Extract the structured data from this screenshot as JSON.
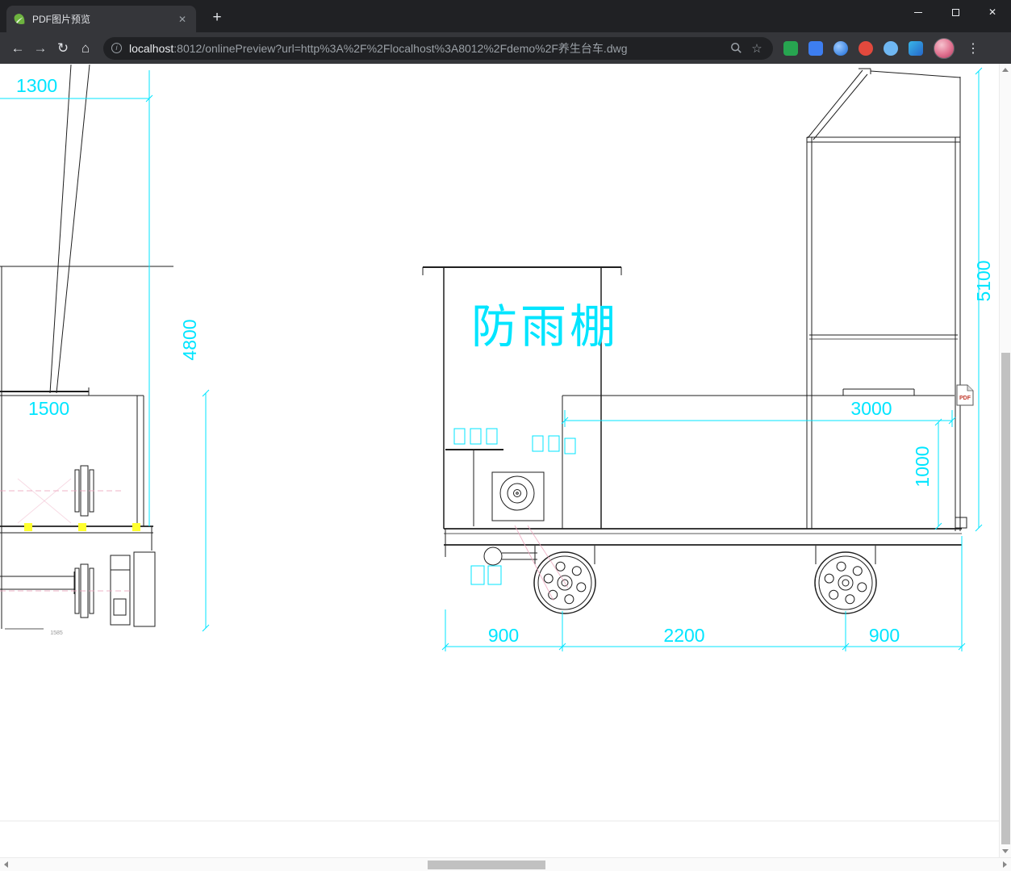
{
  "window": {
    "close_glyph": "✕"
  },
  "tabbar": {
    "tab_title": "PDF图片预览",
    "tab_close_glyph": "✕",
    "new_tab_glyph": "+"
  },
  "toolbar": {
    "back_glyph": "←",
    "forward_glyph": "→",
    "reload_glyph": "↻",
    "home_glyph": "⌂",
    "info_glyph": "i",
    "url_host": "localhost",
    "url_rest": ":8012/onlinePreview?url=http%3A%2F%2Flocalhost%3A8012%2Fdemo%2F养生台车.dwg",
    "star_glyph": "☆",
    "menu_glyph": "⋮",
    "extensions": [
      {
        "name": "green-extension",
        "style": "background:#27a550;border-radius:4px"
      },
      {
        "name": "translate-extension",
        "style": "background:#3d7ef0;border-radius:4px"
      },
      {
        "name": "blue-ball-extension",
        "style": "background:radial-gradient(circle at 35% 35%, #9ecbff, #1668d6);border-radius:50%"
      },
      {
        "name": "red-extension",
        "style": "background:#e2493d;border-radius:50%"
      },
      {
        "name": "cloud-extension",
        "style": "background:#6fb7f2;border-radius:50%"
      },
      {
        "name": "shield-extension",
        "style": "background:linear-gradient(135deg,#38b6e8,#2667c9);border-radius:4px"
      }
    ]
  },
  "drawing": {
    "canopy_label": "防雨棚",
    "pdf_badge": "PDF",
    "dims": {
      "left_width": "1300",
      "left_height": "4800",
      "left_inner": "1500",
      "right_height": "5100",
      "body_width": "3000",
      "body_height": "1000",
      "wheel_left": "900",
      "wheel_span": "2200",
      "wheel_right": "900",
      "left_small": "1585"
    },
    "colors": {
      "dimension_cyan": "#00e5ff",
      "line_black": "#1f1f1f",
      "highlight_yellow": "#ffff2e",
      "centerline_pink": "#eda6bd"
    }
  }
}
